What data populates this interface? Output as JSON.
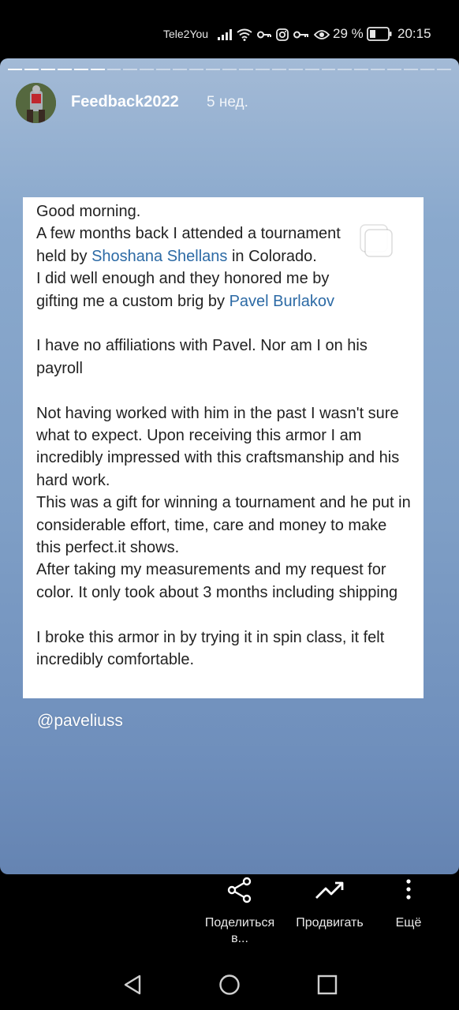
{
  "status_bar": {
    "carrier": "Tele2You",
    "battery_percent": "29 %",
    "time": "20:15"
  },
  "story": {
    "progress": {
      "total_segments": 27,
      "completed_segments": 6
    },
    "username": "Feedback2022",
    "time_ago": "5 нед.",
    "post": {
      "l1": "Good morning.",
      "l2a": "A few months back I attended a tournament",
      "l3a": "held by ",
      "l3_link": "Shoshana Shellans",
      "l3b": " in Colorado.",
      "l4": "I did well enough and they honored me by",
      "l5a": "gifting me a custom brig by ",
      "l5_link": "Pavel Burlakov",
      "p2": "I have no affiliations with Pavel. Nor am I on his payroll",
      "p3": "Not having worked with him in the past I wasn't sure what to expect. Upon receiving this armor I am incredibly impressed with this craftsmanship and his hard work.",
      "p4": "This was a gift for winning a tournament and he put in considerable effort, time, care and money to make this perfect.it shows.",
      "p5": "After taking my measurements and my request for color. It only took about 3 months including shipping",
      "p6": "I broke this armor in by trying it in spin class, it felt incredibly comfortable."
    },
    "mention": "@paveliuss"
  },
  "actions": {
    "share_label": "Поделиться в...",
    "promote_label": "Продвигать",
    "more_label": "Ещё"
  }
}
